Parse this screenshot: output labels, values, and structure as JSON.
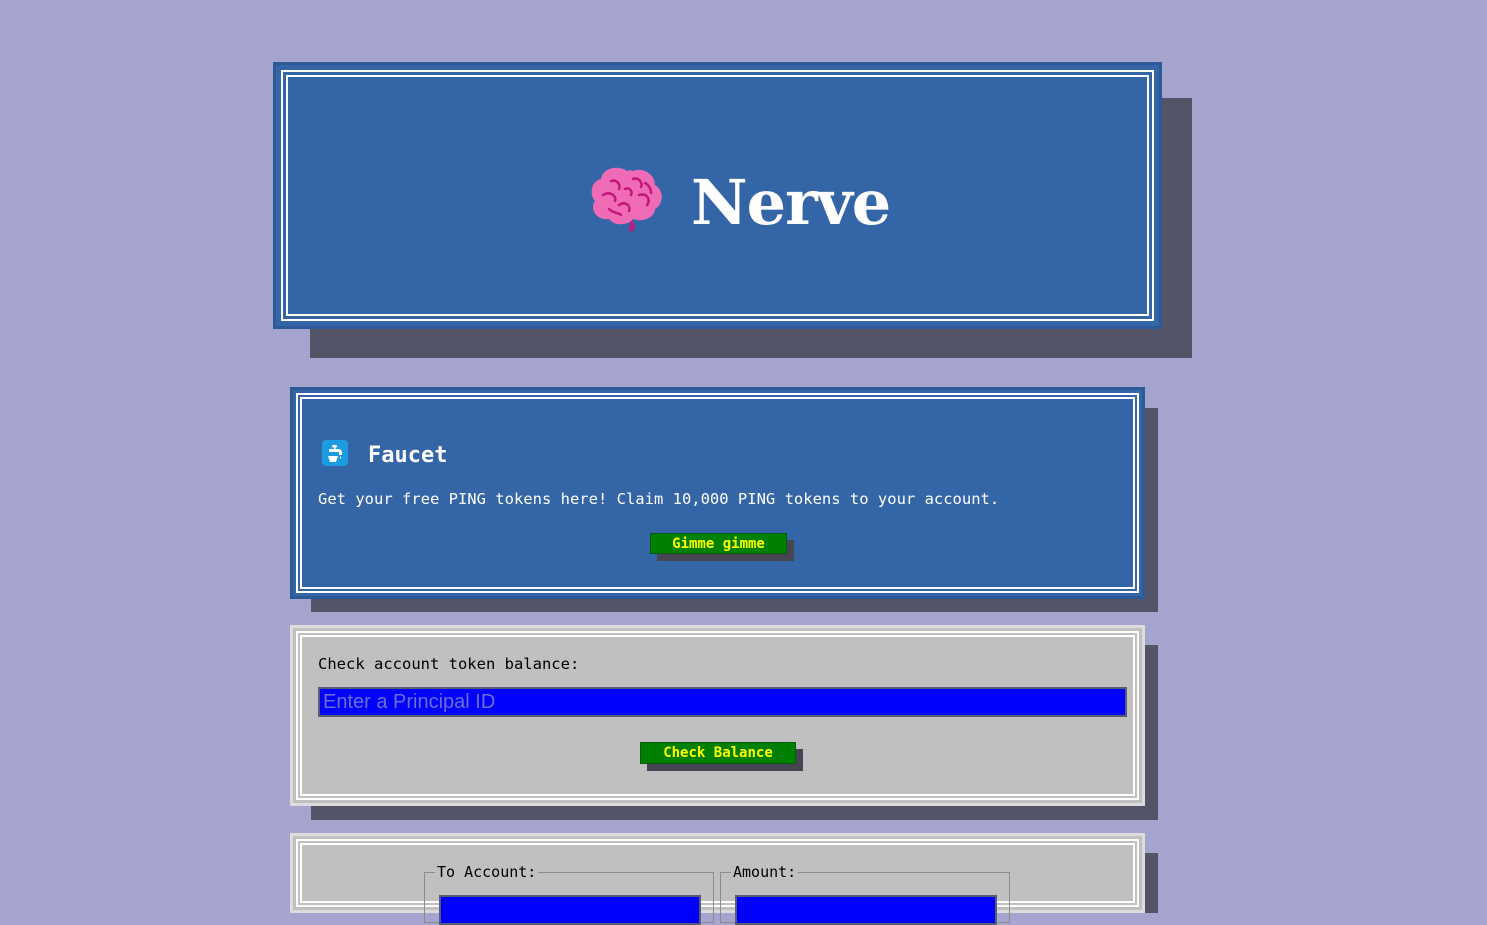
{
  "header": {
    "title": "Nerve",
    "logo_icon": "brain-icon"
  },
  "faucet": {
    "icon": "faucet-icon",
    "title": "Faucet",
    "description": "Get your free PING tokens here! Claim 10,000 PING tokens to your account.",
    "button_label": "Gimme gimme"
  },
  "balance": {
    "label": "Check account token balance:",
    "input_placeholder": "Enter a Principal ID",
    "input_value": "",
    "button_label": "Check Balance"
  },
  "transfer": {
    "to_account_label": "To Account:",
    "amount_label": "Amount:"
  },
  "colors": {
    "background": "#a5a4cf",
    "panel_blue": "#3465a6",
    "panel_gray": "#c0c0c0",
    "button_green": "#008000",
    "button_text": "#ffff00",
    "input_blue": "#0000ff"
  }
}
